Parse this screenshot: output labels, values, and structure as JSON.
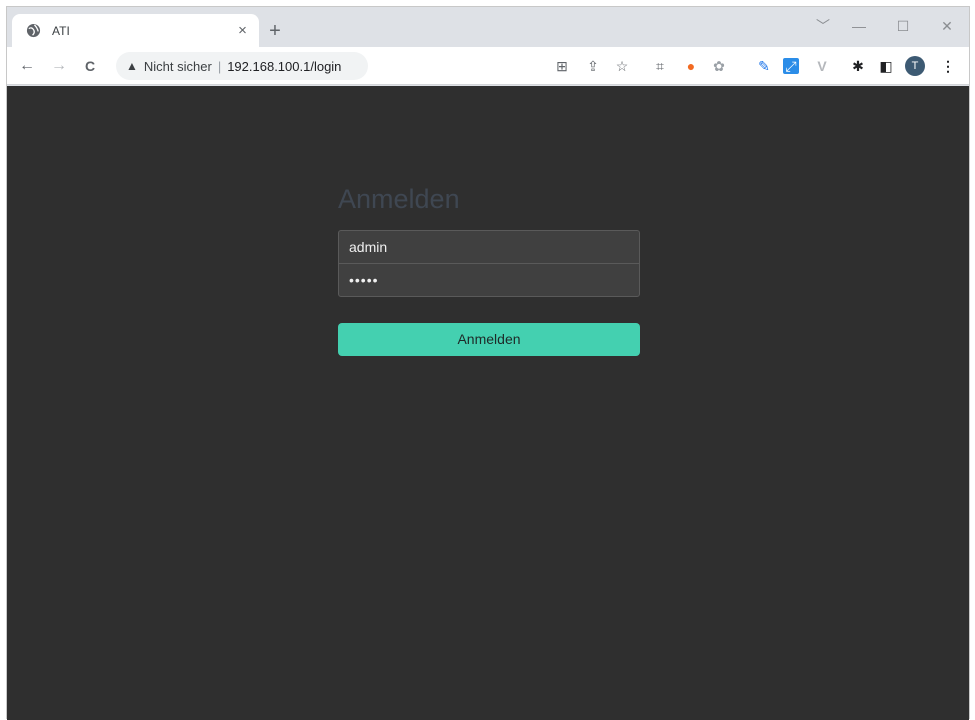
{
  "tab": {
    "title": "ATI",
    "close": "×",
    "new": "+"
  },
  "window_controls": {
    "dropdown": "﹀",
    "minimize": "—",
    "maximize": "☐",
    "close": "✕"
  },
  "nav": {
    "back": "←",
    "forward": "→",
    "reload": "C"
  },
  "omnibox": {
    "warning_icon": "▲",
    "security_label": "Nicht sicher",
    "separator": "|",
    "url": "192.168.100.1/login"
  },
  "extensions": {
    "translate": "⊞",
    "share": "⇪",
    "bookmark": "☆",
    "screenshot": "⌗",
    "ext_orange": "●",
    "ext_gray": "✿",
    "ext_pen": "✎",
    "ext_blue": "⤢",
    "ext_v": "V",
    "puzzle": "✱",
    "sidepanel": "◧",
    "profile": "T",
    "menu": "⋮"
  },
  "login": {
    "title": "Anmelden",
    "username_value": "admin",
    "password_value": "•••••",
    "submit_label": "Anmelden"
  }
}
